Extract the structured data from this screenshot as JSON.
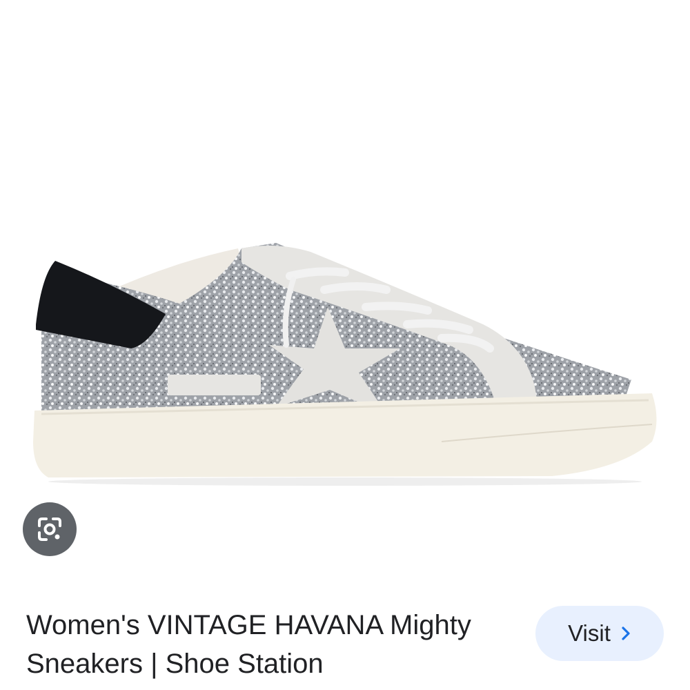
{
  "result": {
    "title_line1": "Women's VINTAGE HAVANA Mighty",
    "title_line2": "Sneakers | Shoe Station",
    "visit_label": "Visit"
  },
  "icons": {
    "lens": "google-lens-icon",
    "visit_chevron": "chevron-right-icon"
  },
  "colors": {
    "visit_button_bg": "#e8f0fe",
    "visit_chevron": "#1a73e8",
    "lens_bg": "#5f6368"
  }
}
